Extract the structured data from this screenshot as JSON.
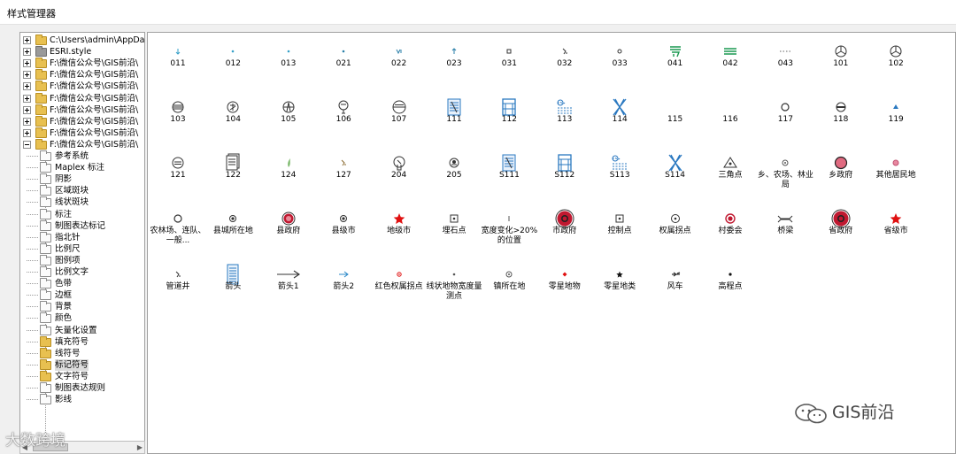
{
  "window": {
    "title": "样式管理器"
  },
  "tree": {
    "items": [
      {
        "label": "C:\\Users\\admin\\AppData\\",
        "expander": "plus",
        "folder": "yellow"
      },
      {
        "label": "ESRI.style",
        "expander": "plus",
        "folder": "grey"
      },
      {
        "label": "F:\\微信公众号\\GIS前沿\\",
        "expander": "plus",
        "folder": "yellow"
      },
      {
        "label": "F:\\微信公众号\\GIS前沿\\",
        "expander": "plus",
        "folder": "yellow"
      },
      {
        "label": "F:\\微信公众号\\GIS前沿\\",
        "expander": "plus",
        "folder": "yellow"
      },
      {
        "label": "F:\\微信公众号\\GIS前沿\\",
        "expander": "plus",
        "folder": "yellow"
      },
      {
        "label": "F:\\微信公众号\\GIS前沿\\",
        "expander": "plus",
        "folder": "yellow"
      },
      {
        "label": "F:\\微信公众号\\GIS前沿\\",
        "expander": "plus",
        "folder": "yellow"
      },
      {
        "label": "F:\\微信公众号\\GIS前沿\\",
        "expander": "plus",
        "folder": "yellow"
      },
      {
        "label": "F:\\微信公众号\\GIS前沿\\",
        "expander": "minus",
        "folder": "yellow"
      }
    ],
    "children": [
      {
        "label": "参考系统",
        "folder": "white"
      },
      {
        "label": "Maplex 标注",
        "folder": "white"
      },
      {
        "label": "阴影",
        "folder": "white"
      },
      {
        "label": "区域斑块",
        "folder": "white"
      },
      {
        "label": "线状斑块",
        "folder": "white"
      },
      {
        "label": "标注",
        "folder": "white"
      },
      {
        "label": "制图表达标记",
        "folder": "white"
      },
      {
        "label": "指北针",
        "folder": "white"
      },
      {
        "label": "比例尺",
        "folder": "white"
      },
      {
        "label": "图例项",
        "folder": "white"
      },
      {
        "label": "比例文字",
        "folder": "white"
      },
      {
        "label": "色带",
        "folder": "white"
      },
      {
        "label": "边框",
        "folder": "white"
      },
      {
        "label": "背景",
        "folder": "white"
      },
      {
        "label": "颜色",
        "folder": "white"
      },
      {
        "label": "矢量化设置",
        "folder": "white"
      },
      {
        "label": "填充符号",
        "folder": "yellow"
      },
      {
        "label": "线符号",
        "folder": "yellow"
      },
      {
        "label": "标记符号",
        "folder": "yellow",
        "selected": true
      },
      {
        "label": "文字符号",
        "folder": "yellow"
      },
      {
        "label": "制图表达规则",
        "folder": "white"
      },
      {
        "label": "影线",
        "folder": "white"
      }
    ]
  },
  "scrollbar": {
    "left_arrow": "◀",
    "right_arrow": "▶"
  },
  "symbols": [
    [
      {
        "label": "011",
        "icon": "tiny-arrow",
        "color": "#36a0c8"
      },
      {
        "label": "012",
        "icon": "tiny-dot",
        "color": "#36a0c8"
      },
      {
        "label": "013",
        "icon": "tiny-dot",
        "color": "#36a0c8"
      },
      {
        "label": "021",
        "icon": "tiny-dot",
        "color": "#2a7fa8"
      },
      {
        "label": "022",
        "icon": "tiny-v",
        "color": "#2a7fa8"
      },
      {
        "label": "023",
        "icon": "tiny-arrow-up",
        "color": "#2a7fa8"
      },
      {
        "label": "031",
        "icon": "small-square",
        "color": "#333333"
      },
      {
        "label": "032",
        "icon": "small-glyph",
        "color": "#333333"
      },
      {
        "label": "033",
        "icon": "small-dot",
        "color": "#333333"
      },
      {
        "label": "041",
        "icon": "green-stamp",
        "color": "#1a9850"
      },
      {
        "label": "042",
        "icon": "green-lines",
        "color": "#1a9850"
      },
      {
        "label": "043",
        "icon": "dotted",
        "color": "#666666"
      },
      {
        "label": "101",
        "icon": "benz-circle",
        "color": "#333333"
      },
      {
        "label": "102",
        "icon": "benz-circle",
        "color": "#333333"
      }
    ],
    [
      {
        "label": "103",
        "icon": "striped-circle",
        "color": "#333333"
      },
      {
        "label": "104",
        "icon": "char-circle",
        "color": "#333333"
      },
      {
        "label": "105",
        "icon": "cross-circle",
        "color": "#333333"
      },
      {
        "label": "106",
        "icon": "flower",
        "color": "#333333"
      },
      {
        "label": "107",
        "icon": "h-circle",
        "color": "#333333"
      },
      {
        "label": "111",
        "icon": "blue-doc",
        "color": "#2a78c0"
      },
      {
        "label": "112",
        "icon": "blue-gate",
        "color": "#2a78c0"
      },
      {
        "label": "113",
        "icon": "blue-wave",
        "color": "#2a78c0"
      },
      {
        "label": "114",
        "icon": "blue-x",
        "color": "#2a78c0"
      },
      {
        "label": "115",
        "icon": "none",
        "color": "#333333"
      },
      {
        "label": "116",
        "icon": "none",
        "color": "#333333"
      },
      {
        "label": "117",
        "icon": "ring",
        "color": "#333333"
      },
      {
        "label": "118",
        "icon": "half-circle",
        "color": "#333333"
      },
      {
        "label": "119",
        "icon": "blue-triangle",
        "color": "#2a78c0"
      }
    ],
    [
      {
        "label": "121",
        "icon": "text-circle",
        "color": "#333333"
      },
      {
        "label": "122",
        "icon": "doc-stack",
        "color": "#333333"
      },
      {
        "label": "124",
        "icon": "leaf",
        "color": "#7ab86a"
      },
      {
        "label": "127",
        "icon": "small-glyph",
        "color": "#8a6a30"
      },
      {
        "label": "204",
        "icon": "hand-circle",
        "color": "#333333"
      },
      {
        "label": "205",
        "icon": "dot-circle",
        "color": "#333333"
      },
      {
        "label": "S111",
        "icon": "blue-doc",
        "color": "#2a78c0"
      },
      {
        "label": "S112",
        "icon": "blue-gate",
        "color": "#2a78c0"
      },
      {
        "label": "S113",
        "icon": "blue-wave",
        "color": "#2a78c0"
      },
      {
        "label": "S114",
        "icon": "blue-x",
        "color": "#2a78c0"
      },
      {
        "label": "三角点",
        "icon": "triangle-dot",
        "color": "#333333"
      },
      {
        "label": "乡、农场、林业局",
        "icon": "small-target",
        "color": "#555555"
      },
      {
        "label": "乡政府",
        "icon": "pink-circle",
        "color": "#e06a80"
      },
      {
        "label": "其他居民地",
        "icon": "small-pink",
        "color": "#c05070"
      }
    ],
    [
      {
        "label": "农林场、连队、一般...",
        "icon": "ring",
        "color": "#333333"
      },
      {
        "label": "县城所在地",
        "icon": "bullseye-small",
        "color": "#333333"
      },
      {
        "label": "县政府",
        "icon": "red-double",
        "color": "#c01830"
      },
      {
        "label": "县级市",
        "icon": "bullseye-small",
        "color": "#333333"
      },
      {
        "label": "地级市",
        "icon": "red-star",
        "color": "#e01010"
      },
      {
        "label": "埋石点",
        "icon": "square-dot",
        "color": "#333333"
      },
      {
        "label": "宽度变化>20%的位置",
        "icon": "tick",
        "color": "#555555"
      },
      {
        "label": "市政府",
        "icon": "red-big",
        "color": "#c01830"
      },
      {
        "label": "控制点",
        "icon": "square-dot",
        "color": "#333333"
      },
      {
        "label": "权属拐点",
        "icon": "ring-dot",
        "color": "#333333"
      },
      {
        "label": "村委会",
        "icon": "red-ring",
        "color": "#c01830"
      },
      {
        "label": "桥梁",
        "icon": "bridge",
        "color": "#333333"
      },
      {
        "label": "省政府",
        "icon": "red-big",
        "color": "#c01830"
      },
      {
        "label": "省级市",
        "icon": "red-star",
        "color": "#e01010"
      }
    ],
    [
      {
        "label": "管道井",
        "icon": "small-glyph",
        "color": "#333333"
      },
      {
        "label": "箭头",
        "icon": "lined-page",
        "color": "#2a78c0"
      },
      {
        "label": "箭头1",
        "icon": "long-arrow",
        "color": "#333333"
      },
      {
        "label": "箭头2",
        "icon": "short-arrow",
        "color": "#2a88c8"
      },
      {
        "label": "红色权属拐点",
        "icon": "red-tiny-ring",
        "color": "#e01010"
      },
      {
        "label": "线状地物宽度量测点",
        "icon": "tiny-dot",
        "color": "#555555"
      },
      {
        "label": "镇所在地",
        "icon": "small-target",
        "color": "#555555"
      },
      {
        "label": "零星地物",
        "icon": "red-diamond",
        "color": "#e01010"
      },
      {
        "label": "零星地类",
        "icon": "black-star",
        "color": "#111111"
      },
      {
        "label": "风车",
        "icon": "windmill",
        "color": "#333333"
      },
      {
        "label": "高程点",
        "icon": "black-dot",
        "color": "#111111"
      }
    ]
  ],
  "watermarks": {
    "right": "GIS前沿",
    "left": "大数跨境"
  }
}
